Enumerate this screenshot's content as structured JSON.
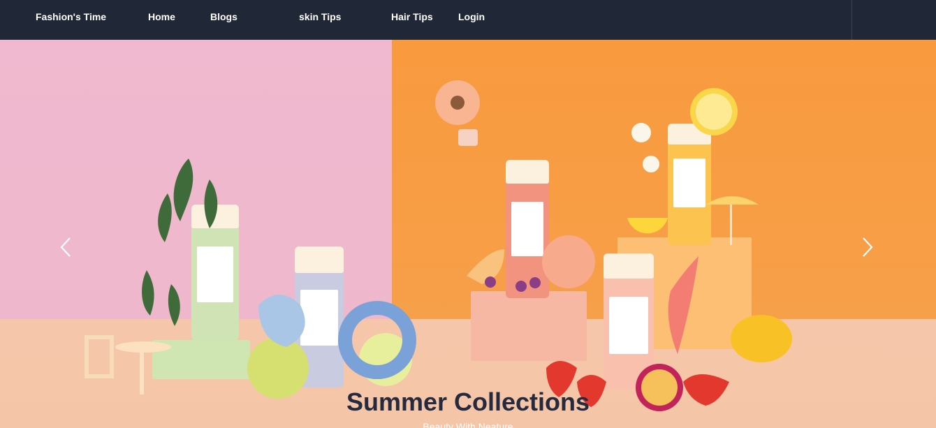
{
  "navbar": {
    "brand": "Fashion's Time",
    "links": [
      "Home",
      "Blogs",
      "skin Tips",
      "Hair Tips",
      "Login"
    ]
  },
  "hero": {
    "title": "Summer Collections",
    "subtitle": "Beauty With Neature"
  },
  "icons": {
    "prev": "chevron-left-icon",
    "next": "chevron-right-icon"
  },
  "colors": {
    "navbar": "#202837",
    "pink_wall": "#efb7cb",
    "orange_wall": "#f99a3e",
    "title": "#262a3e"
  }
}
